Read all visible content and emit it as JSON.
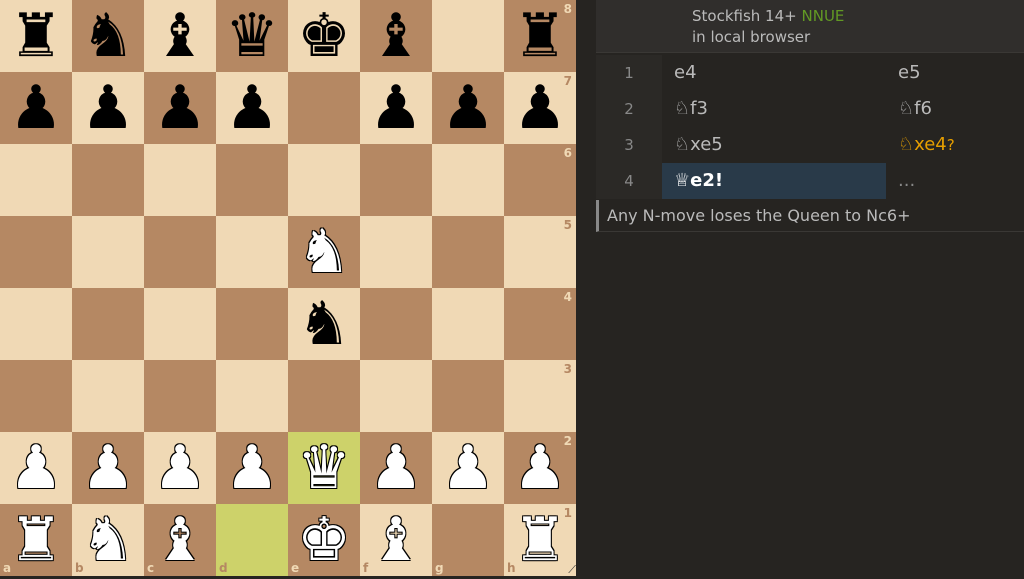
{
  "board": {
    "files": [
      "a",
      "b",
      "c",
      "d",
      "e",
      "f",
      "g",
      "h"
    ],
    "ranks": [
      "8",
      "7",
      "6",
      "5",
      "4",
      "3",
      "2",
      "1"
    ],
    "highlighted": [
      "d1",
      "e2"
    ],
    "pieces": {
      "a8": {
        "color": "b",
        "glyph": "♜",
        "name": "black-rook"
      },
      "b8": {
        "color": "b",
        "glyph": "♞",
        "name": "black-knight"
      },
      "c8": {
        "color": "b",
        "glyph": "♝",
        "name": "black-bishop"
      },
      "d8": {
        "color": "b",
        "glyph": "♛",
        "name": "black-queen"
      },
      "e8": {
        "color": "b",
        "glyph": "♚",
        "name": "black-king"
      },
      "f8": {
        "color": "b",
        "glyph": "♝",
        "name": "black-bishop"
      },
      "h8": {
        "color": "b",
        "glyph": "♜",
        "name": "black-rook"
      },
      "a7": {
        "color": "b",
        "glyph": "♟",
        "name": "black-pawn"
      },
      "b7": {
        "color": "b",
        "glyph": "♟",
        "name": "black-pawn"
      },
      "c7": {
        "color": "b",
        "glyph": "♟",
        "name": "black-pawn"
      },
      "d7": {
        "color": "b",
        "glyph": "♟",
        "name": "black-pawn"
      },
      "f7": {
        "color": "b",
        "glyph": "♟",
        "name": "black-pawn"
      },
      "g7": {
        "color": "b",
        "glyph": "♟",
        "name": "black-pawn"
      },
      "h7": {
        "color": "b",
        "glyph": "♟",
        "name": "black-pawn"
      },
      "e5": {
        "color": "w",
        "glyph": "♞",
        "name": "white-knight"
      },
      "e4": {
        "color": "b",
        "glyph": "♞",
        "name": "black-knight"
      },
      "a2": {
        "color": "w",
        "glyph": "♟",
        "name": "white-pawn"
      },
      "b2": {
        "color": "w",
        "glyph": "♟",
        "name": "white-pawn"
      },
      "c2": {
        "color": "w",
        "glyph": "♟",
        "name": "white-pawn"
      },
      "d2": {
        "color": "w",
        "glyph": "♟",
        "name": "white-pawn"
      },
      "e2": {
        "color": "w",
        "glyph": "♛",
        "name": "white-queen"
      },
      "f2": {
        "color": "w",
        "glyph": "♟",
        "name": "white-pawn"
      },
      "g2": {
        "color": "w",
        "glyph": "♟",
        "name": "white-pawn"
      },
      "h2": {
        "color": "w",
        "glyph": "♟",
        "name": "white-pawn"
      },
      "a1": {
        "color": "w",
        "glyph": "♜",
        "name": "white-rook"
      },
      "b1": {
        "color": "w",
        "glyph": "♞",
        "name": "white-knight"
      },
      "c1": {
        "color": "w",
        "glyph": "♝",
        "name": "white-bishop"
      },
      "e1": {
        "color": "w",
        "glyph": "♚",
        "name": "white-king"
      },
      "f1": {
        "color": "w",
        "glyph": "♝",
        "name": "white-bishop"
      },
      "h1": {
        "color": "w",
        "glyph": "♜",
        "name": "white-rook"
      }
    },
    "resize_glyph": "⟋"
  },
  "engine": {
    "name": "Stockfish 14+",
    "badge": "NNUE",
    "location": "in local browser"
  },
  "moves": [
    {
      "num": "1",
      "white": {
        "text": "e4"
      },
      "black": {
        "text": "e5"
      }
    },
    {
      "num": "2",
      "white": {
        "text": "♘f3"
      },
      "black": {
        "text": "♘f6"
      }
    },
    {
      "num": "3",
      "white": {
        "text": "♘xe5"
      },
      "black": {
        "text": "♘xe4",
        "suffix": "?"
      }
    },
    {
      "num": "4",
      "white": {
        "text": "♕e2",
        "suffix": "!"
      },
      "black": {
        "text": "..."
      }
    }
  ],
  "comment": "Any N-move loses the Queen to Nc6+",
  "colors": {
    "light_square": "#f0d9b5",
    "dark_square": "#b58863",
    "highlight": "#cdd26a",
    "active_move_bg": "#293a49",
    "mistake": "#e69f00",
    "nnue": "#629924"
  }
}
